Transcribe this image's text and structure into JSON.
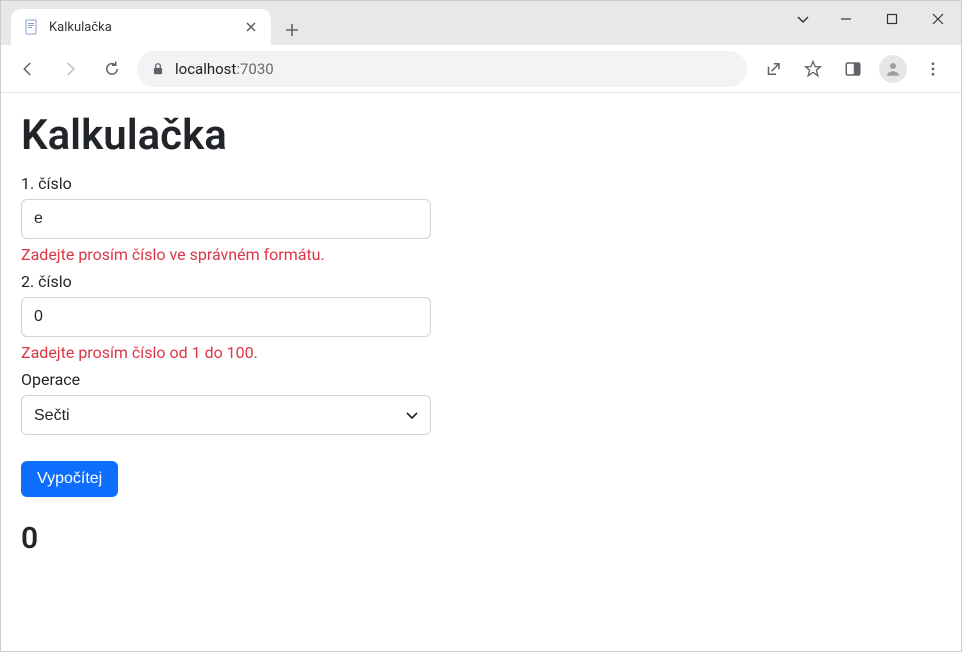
{
  "browser": {
    "tab_title": "Kalkulačka",
    "url_host": "localhost",
    "url_port": ":7030"
  },
  "page": {
    "title": "Kalkulačka",
    "fields": {
      "num1": {
        "label": "1. číslo",
        "value": "e",
        "error": "Zadejte prosím číslo ve správném formátu."
      },
      "num2": {
        "label": "2. číslo",
        "value": "0",
        "error": "Zadejte prosím číslo od 1 do 100."
      },
      "operation": {
        "label": "Operace",
        "selected": "Sečti"
      }
    },
    "submit_label": "Vypočítej",
    "result": "0"
  }
}
